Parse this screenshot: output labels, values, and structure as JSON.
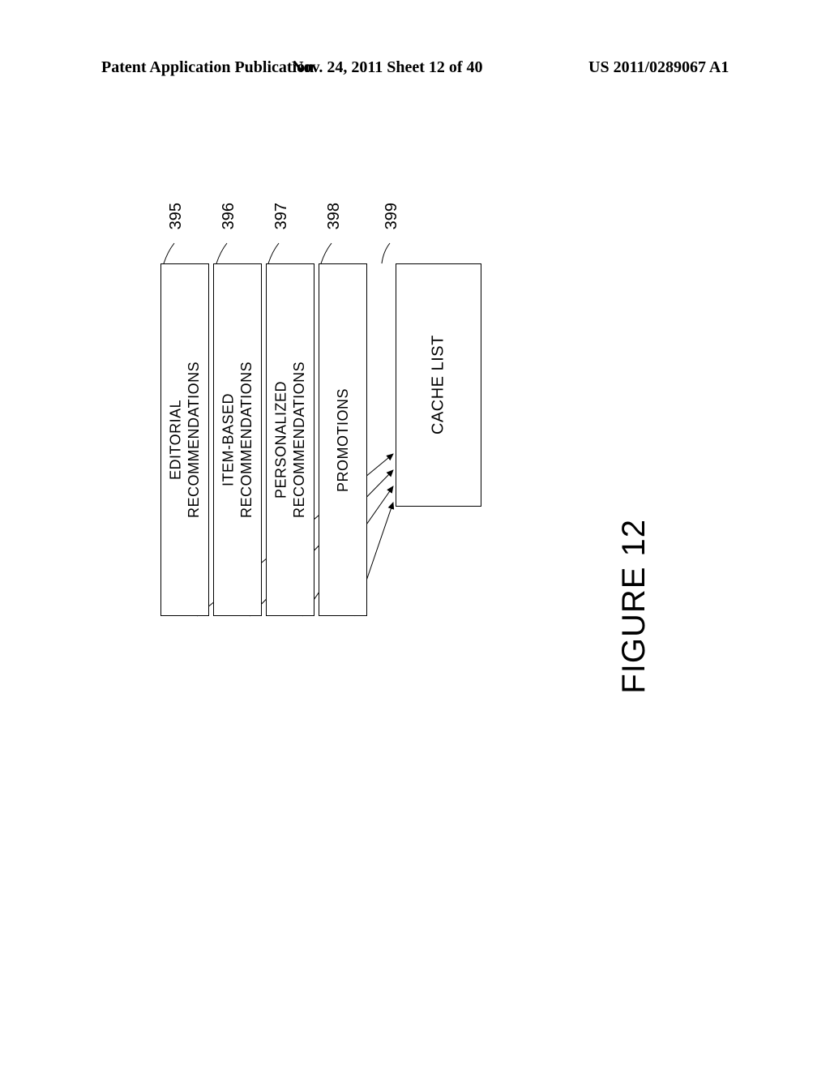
{
  "header": {
    "left": "Patent Application Publication",
    "center": "Nov. 24, 2011  Sheet 12 of 40",
    "right": "US 2011/0289067 A1"
  },
  "boxes": {
    "editorial": {
      "ref": "395",
      "label": "EDITORIAL\nRECOMMENDATIONS"
    },
    "item_based": {
      "ref": "396",
      "label": "ITEM-BASED\nRECOMMENDATIONS"
    },
    "personalized": {
      "ref": "397",
      "label": "PERSONALIZED\nRECOMMENDATIONS"
    },
    "promotions": {
      "ref": "398",
      "label": "PROMOTIONS"
    },
    "cache": {
      "ref": "399",
      "label": "CACHE LIST"
    }
  },
  "figure_title": "FIGURE 12"
}
